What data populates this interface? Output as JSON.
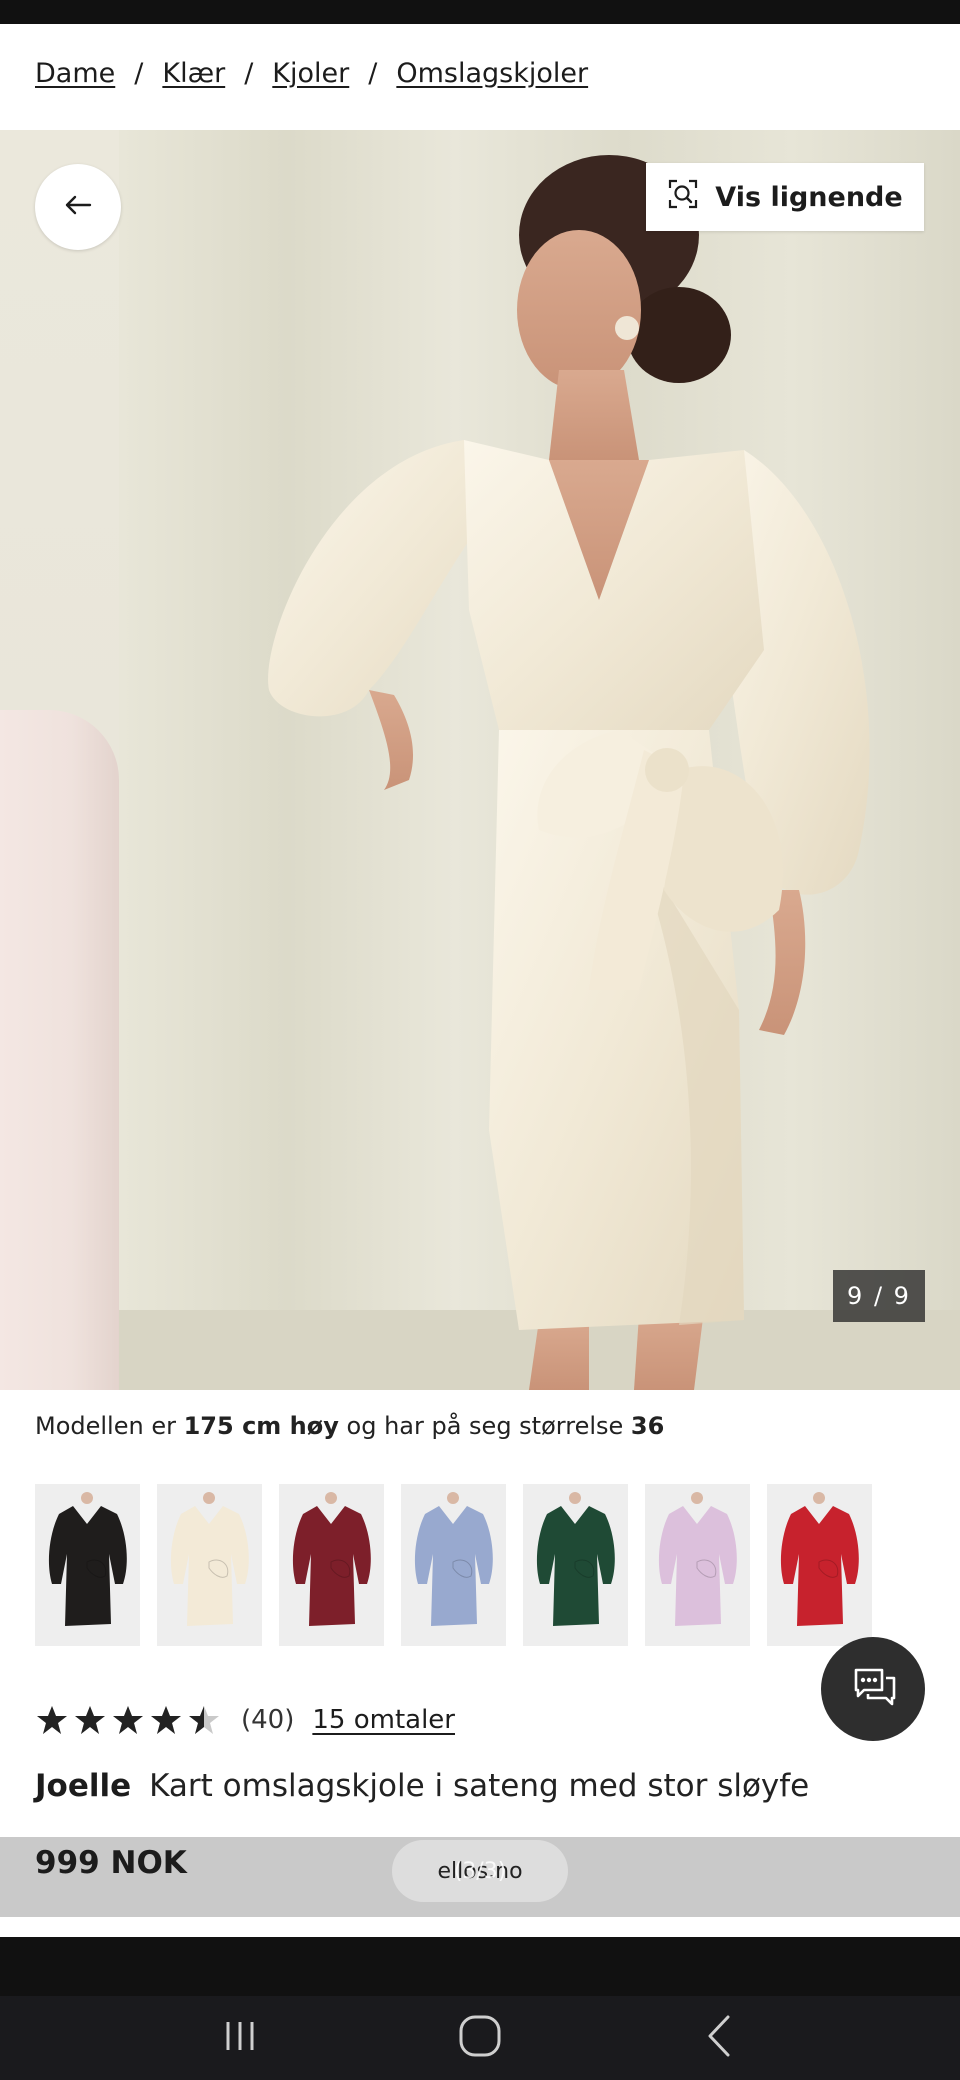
{
  "breadcrumb": {
    "items": [
      {
        "label": "Dame"
      },
      {
        "label": "Klær"
      },
      {
        "label": "Kjoler"
      },
      {
        "label": "Omslagskjoler"
      }
    ],
    "separator": "/"
  },
  "gallery": {
    "back_icon": "arrow-left-icon",
    "similar_button_label": "Vis lignende",
    "similar_icon": "visual-search-icon",
    "image_counter": "9 / 9",
    "current_image": 9,
    "total_images": 9
  },
  "model_info": {
    "prefix": "Modellen er",
    "height": "175 cm høy",
    "middle": "og har på seg størrelse",
    "size": "36"
  },
  "colors": {
    "variants": [
      {
        "name": "black",
        "hex": "#1f1d1c"
      },
      {
        "name": "ivory",
        "hex": "#f3ead7"
      },
      {
        "name": "burgundy",
        "hex": "#7d1f2a"
      },
      {
        "name": "light-blue",
        "hex": "#98a9cf"
      },
      {
        "name": "dark-green",
        "hex": "#1f4a35"
      },
      {
        "name": "lilac",
        "hex": "#dcc0dc"
      },
      {
        "name": "red",
        "hex": "#c7222d"
      }
    ]
  },
  "rating": {
    "stars": 4.5,
    "max_stars": 5,
    "count_label": "(40)",
    "reviews_link": "15 omtaler"
  },
  "product": {
    "brand": "Joelle",
    "name": "Kart omslagskjole i sateng med stor sløyfe",
    "price": "999 NOK"
  },
  "toast": {
    "text": "ellos.no",
    "overlay_text": "(3/3)"
  },
  "chat": {
    "icon": "chat-bubble-icon"
  },
  "navbar": {
    "icons": [
      "recent-apps-icon",
      "home-icon",
      "back-icon"
    ]
  }
}
